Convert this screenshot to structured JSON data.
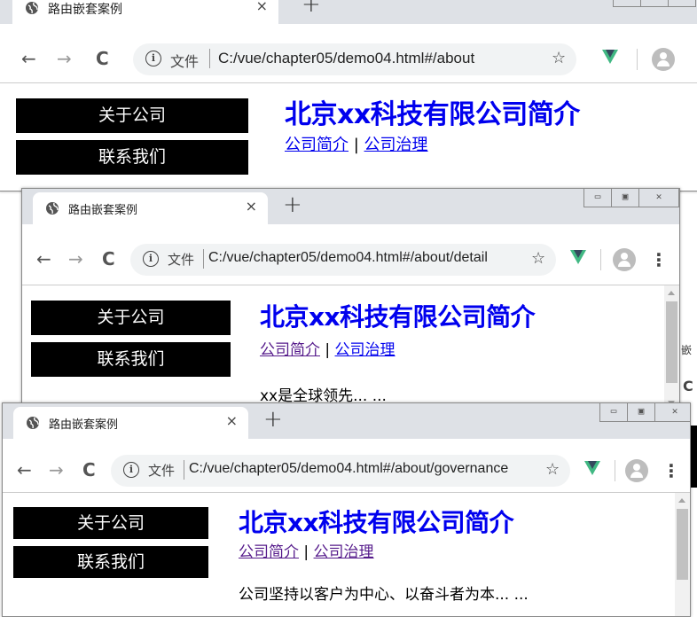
{
  "windows": [
    {
      "tab_title": "路由嵌套案例",
      "tab_close": "×",
      "new_tab": "+",
      "file_label": "文件",
      "url": "C:/vue/chapter05/demo04.html#/about",
      "menu": [
        "关于公司",
        "联系我们"
      ],
      "heading": "北京xx科技有限公司简介",
      "link_intro": "公司简介",
      "link_separator": "|",
      "link_governance": "公司治理",
      "body_text": ""
    },
    {
      "tab_title": "路由嵌套案例",
      "tab_close": "×",
      "new_tab": "+",
      "file_label": "文件",
      "url": "C:/vue/chapter05/demo04.html#/about/detail",
      "menu": [
        "关于公司",
        "联系我们"
      ],
      "heading": "北京xx科技有限公司简介",
      "link_intro": "公司简介",
      "link_separator": "|",
      "link_governance": "公司治理",
      "body_text": "xx是全球领先... ..."
    },
    {
      "tab_title": "路由嵌套案例",
      "tab_close": "×",
      "new_tab": "+",
      "file_label": "文件",
      "url": "C:/vue/chapter05/demo04.html#/about/governance",
      "menu": [
        "关于公司",
        "联系我们"
      ],
      "heading": "北京xx科技有限公司简介",
      "link_intro": "公司简介",
      "link_separator": "|",
      "link_governance": "公司治理",
      "body_text": "公司坚持以客户为中心、以奋斗者为本... ..."
    }
  ],
  "peek": {
    "text_fragment": "嵌",
    "letter_fragment": "C"
  },
  "colors": {
    "link": "#0000ee",
    "visited_link": "#551a8b",
    "vue_green": "#41b883",
    "menu_bg": "#000000"
  }
}
